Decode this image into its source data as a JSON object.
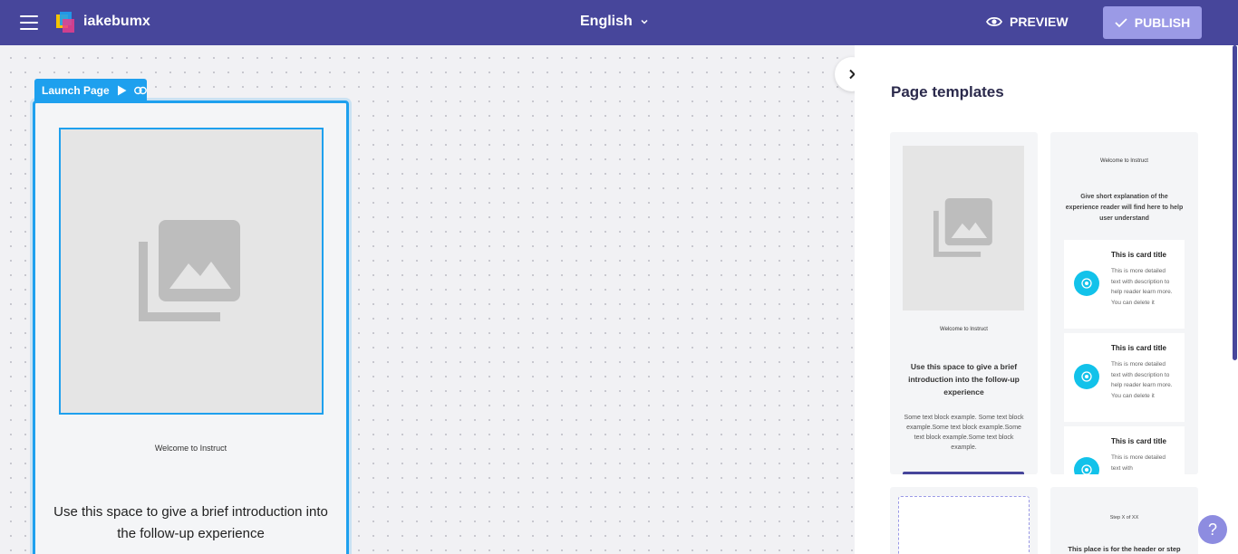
{
  "header": {
    "brand": "iakebumx",
    "language": "English",
    "preview_label": "PREVIEW",
    "publish_label": "PUBLISH"
  },
  "canvas": {
    "page_label": "Launch Page",
    "welcome_text": "Welcome to Instruct",
    "intro_text": "Use this space to give a brief introduction into the follow-up experience"
  },
  "panel": {
    "title": "Page templates",
    "templates": [
      {
        "welcome": "Welcome to Instruct",
        "intro": "Use this space to give a brief introduction into the follow-up experience",
        "body": "Some text block example. Some text block example.Some text block example.Some text block example.Some text block example."
      },
      {
        "welcome": "Welcome to Instruct",
        "explanation": "Give short explanation of the experience reader will find here to help user understand",
        "cards": [
          {
            "title": "This is card title",
            "text": "This is more detailed text with description to help reader learn more. You can delete it"
          },
          {
            "title": "This is card title",
            "text": "This is more detailed text with description to help reader learn more. You can delete it"
          },
          {
            "title": "This is card title",
            "text": "This is more detailed text with"
          }
        ]
      },
      {},
      {
        "step": "Step X of XX",
        "header": "This place is for the header or step"
      }
    ]
  },
  "help_label": "?",
  "colors": {
    "topbar": "#47469b",
    "accent": "#1ea0ee",
    "publish": "#9b9ae6",
    "card_icon": "#12c2ea"
  },
  "icons": [
    "menu-icon",
    "logo-icon",
    "chevron-down-icon",
    "eye-icon",
    "check-icon",
    "play-icon",
    "link-icon",
    "image-placeholder-icon",
    "chevron-right-icon",
    "help-icon"
  ]
}
